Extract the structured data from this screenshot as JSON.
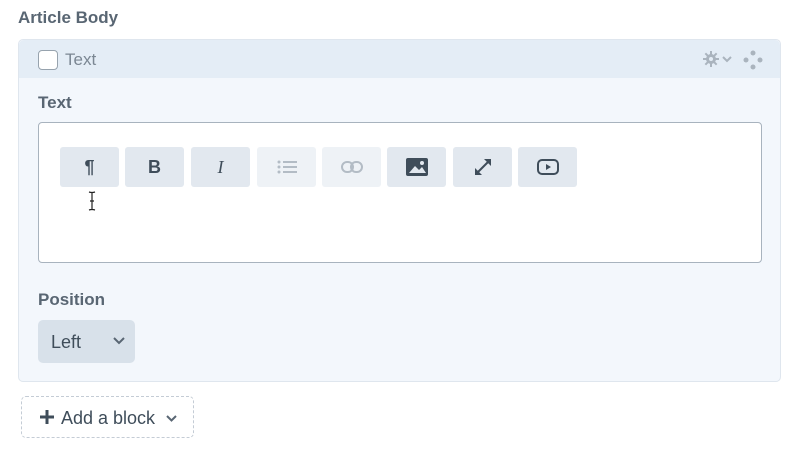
{
  "field": {
    "label": "Article Body"
  },
  "block": {
    "type_label": "Text",
    "text_field_label": "Text",
    "position_label": "Position",
    "position_value": "Left"
  },
  "toolbar": {
    "buttons": [
      {
        "name": "paragraph",
        "glyph": "¶",
        "enabled": true
      },
      {
        "name": "bold",
        "glyph": "B",
        "enabled": true
      },
      {
        "name": "italic",
        "glyph": "I",
        "enabled": true
      },
      {
        "name": "list",
        "icon": "list-icon",
        "enabled": false
      },
      {
        "name": "link",
        "icon": "link-icon",
        "enabled": false
      },
      {
        "name": "image",
        "icon": "image-icon",
        "enabled": true
      },
      {
        "name": "fullscreen",
        "icon": "expand-icon",
        "enabled": true
      },
      {
        "name": "video",
        "icon": "video-icon",
        "enabled": true
      }
    ]
  },
  "add_block": {
    "label": "Add a block"
  },
  "colors": {
    "header_bg": "#e4edf6",
    "block_bg": "#f3f7fc",
    "button_bg": "#e2e8ef",
    "text": "#3f4d5a"
  }
}
